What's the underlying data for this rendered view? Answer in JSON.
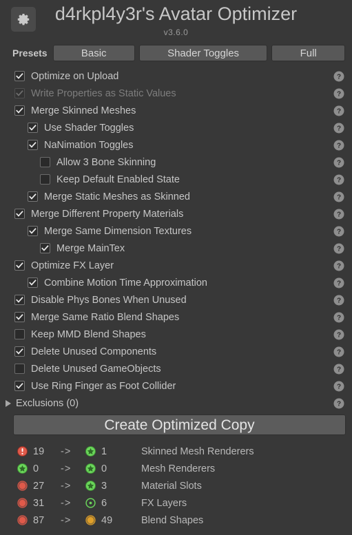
{
  "header": {
    "gear_icon": "gear-icon",
    "title": "d4rkpl4y3r's Avatar Optimizer",
    "version": "v3.6.0"
  },
  "presets": {
    "label": "Presets",
    "buttons": [
      {
        "label": "Basic"
      },
      {
        "label": "Shader Toggles"
      },
      {
        "label": "Full"
      }
    ]
  },
  "options": [
    {
      "label": "Optimize on Upload",
      "checked": true,
      "indent": 0,
      "disabled": false,
      "help_icon": "help-icon"
    },
    {
      "label": "Write Properties as Static Values",
      "checked": true,
      "indent": 0,
      "disabled": true,
      "help_icon": "help-icon"
    },
    {
      "label": "Merge Skinned Meshes",
      "checked": true,
      "indent": 0,
      "disabled": false,
      "help_icon": "help-icon"
    },
    {
      "label": "Use Shader Toggles",
      "checked": true,
      "indent": 1,
      "disabled": false,
      "help_icon": "help-icon"
    },
    {
      "label": "NaNimation Toggles",
      "checked": true,
      "indent": 1,
      "disabled": false,
      "help_icon": "help-icon"
    },
    {
      "label": "Allow 3 Bone Skinning",
      "checked": false,
      "indent": 2,
      "disabled": false,
      "help_icon": "help-icon"
    },
    {
      "label": "Keep Default Enabled State",
      "checked": false,
      "indent": 2,
      "disabled": false,
      "help_icon": "help-icon"
    },
    {
      "label": "Merge Static Meshes as Skinned",
      "checked": true,
      "indent": 1,
      "disabled": false,
      "help_icon": "help-icon"
    },
    {
      "label": "Merge Different Property Materials",
      "checked": true,
      "indent": 0,
      "disabled": false,
      "help_icon": "help-icon"
    },
    {
      "label": "Merge Same Dimension Textures",
      "checked": true,
      "indent": 1,
      "disabled": false,
      "help_icon": "help-icon"
    },
    {
      "label": "Merge MainTex",
      "checked": true,
      "indent": 2,
      "disabled": false,
      "help_icon": "help-icon"
    },
    {
      "label": "Optimize FX Layer",
      "checked": true,
      "indent": 0,
      "disabled": false,
      "help_icon": "help-icon"
    },
    {
      "label": "Combine Motion Time Approximation",
      "checked": true,
      "indent": 1,
      "disabled": false,
      "help_icon": "help-icon"
    },
    {
      "label": "Disable Phys Bones When Unused",
      "checked": true,
      "indent": 0,
      "disabled": false,
      "help_icon": "help-icon"
    },
    {
      "label": "Merge Same Ratio Blend Shapes",
      "checked": true,
      "indent": 0,
      "disabled": false,
      "help_icon": "help-icon"
    },
    {
      "label": "Keep MMD Blend Shapes",
      "checked": false,
      "indent": 0,
      "disabled": false,
      "help_icon": "help-icon"
    },
    {
      "label": "Delete Unused Components",
      "checked": true,
      "indent": 0,
      "disabled": false,
      "help_icon": "help-icon"
    },
    {
      "label": "Delete Unused GameObjects",
      "checked": false,
      "indent": 0,
      "disabled": false,
      "help_icon": "help-icon"
    },
    {
      "label": "Use Ring Finger as Foot Collider",
      "checked": true,
      "indent": 0,
      "disabled": false,
      "help_icon": "help-icon"
    }
  ],
  "exclusions": {
    "label": "Exclusions (0)",
    "expanded": false,
    "foldout_icon": "chevron-right-icon",
    "help_icon": "help-icon"
  },
  "create_button": {
    "label": "Create Optimized Copy"
  },
  "stats": {
    "arrow": "->",
    "rows": [
      {
        "name": "Skinned Mesh Renderers",
        "before": "19",
        "after": "1",
        "before_icon": "error-circle-icon",
        "after_icon": "star-circle-icon",
        "before_color": "#e05a4a",
        "after_color": "#6ad55a"
      },
      {
        "name": "Mesh Renderers",
        "before": "0",
        "after": "0",
        "before_icon": "star-circle-icon",
        "after_icon": "star-circle-icon",
        "before_color": "#6ad55a",
        "after_color": "#6ad55a"
      },
      {
        "name": "Material Slots",
        "before": "27",
        "after": "3",
        "before_icon": "dot-circle-icon",
        "after_icon": "star-circle-icon",
        "before_color": "#e05a4a",
        "after_color": "#6ad55a"
      },
      {
        "name": "FX Layers",
        "before": "31",
        "after": "6",
        "before_icon": "dot-circle-icon",
        "after_icon": "ring-dot-icon",
        "before_color": "#e05a4a",
        "after_color": "#6ad55a"
      },
      {
        "name": "Blend Shapes",
        "before": "87",
        "after": "49",
        "before_icon": "dot-circle-icon",
        "after_icon": "dot-circle-icon",
        "before_color": "#e05a4a",
        "after_color": "#e0a02a"
      }
    ]
  },
  "colors": {
    "background": "#383838",
    "panel": "#383838",
    "text": "#c6c6c6",
    "text_dim": "#7d7d7d",
    "button": "#585858",
    "good": "#6ad55a",
    "bad": "#e05a4a",
    "warn": "#e0a02a"
  }
}
